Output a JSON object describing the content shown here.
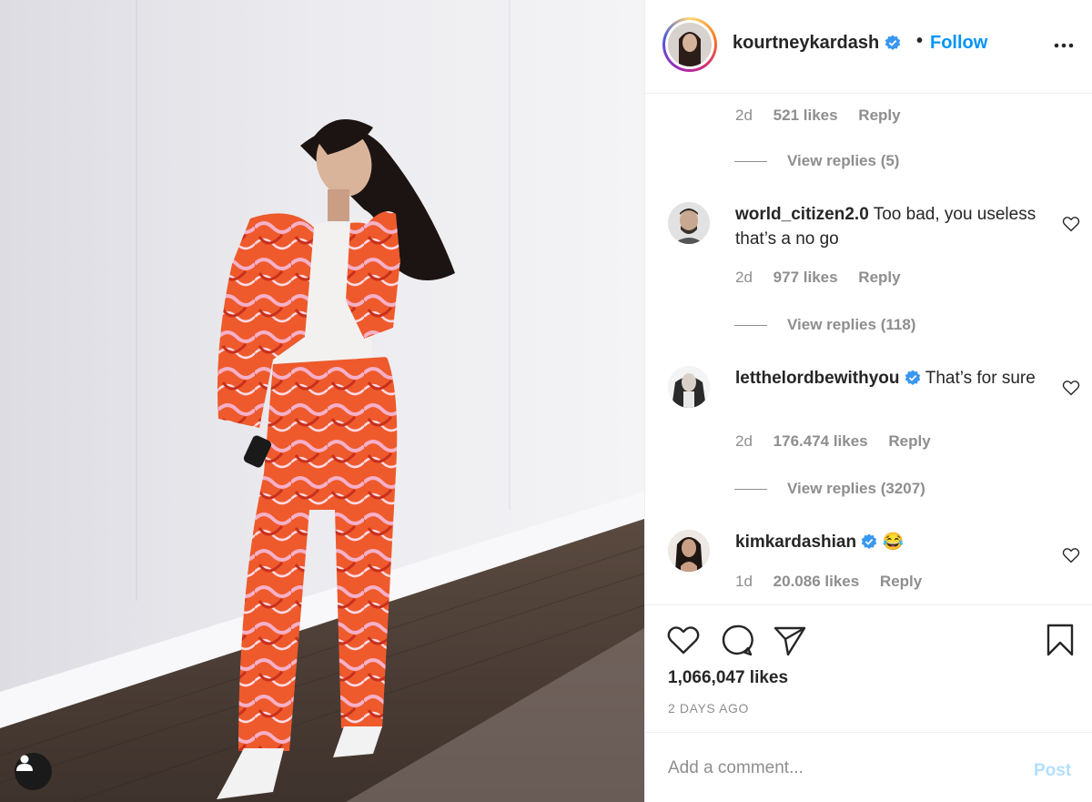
{
  "post": {
    "author": "kourtneykardash",
    "follow_label": "Follow",
    "separator": "•",
    "likes_text": "1,066,047 likes",
    "time_ago": "2 DAYS AGO"
  },
  "comments": [
    {
      "time": "2d",
      "likes": "521 likes",
      "reply": "Reply",
      "view_replies": "View replies (5)"
    },
    {
      "user": "world_citizen2.0",
      "text": "Too bad, you useless that’s a no go",
      "time": "2d",
      "likes": "977 likes",
      "reply": "Reply",
      "view_replies": "View replies (118)"
    },
    {
      "user": "letthelordbewithyou",
      "text": "That’s for sure",
      "time": "2d",
      "likes": "176.474 likes",
      "reply": "Reply",
      "view_replies": "View replies (3207)"
    },
    {
      "user": "kimkardashian",
      "text": "😂",
      "time": "1d",
      "likes": "20.086 likes",
      "reply": "Reply"
    }
  ],
  "add_comment": {
    "placeholder": "Add a comment...",
    "post_label": "Post"
  },
  "colors": {
    "accent": "#0095f6",
    "post_disabled": "#b2dffc",
    "muted": "#8e8e8e"
  }
}
